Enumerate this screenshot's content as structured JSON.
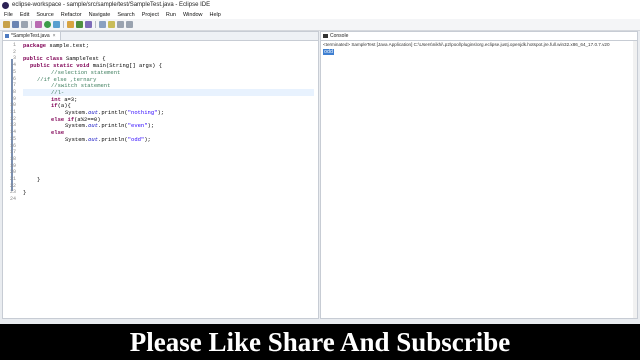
{
  "window": {
    "title": "eclipse-workspace - sample/src/sample/test/SampleTest.java - Eclipse IDE"
  },
  "menu": [
    "File",
    "Edit",
    "Source",
    "Refactor",
    "Navigate",
    "Search",
    "Project",
    "Run",
    "Window",
    "Help"
  ],
  "editor": {
    "tab_label": "*SampleTest.java",
    "lines": [
      {
        "n": "1",
        "t": ""
      },
      {
        "n": "2",
        "t": ""
      },
      {
        "n": "3",
        "t": ""
      },
      {
        "n": "4",
        "t": ""
      },
      {
        "n": "5",
        "t": ""
      },
      {
        "n": "6",
        "t": ""
      },
      {
        "n": "7",
        "t": ""
      },
      {
        "n": "8",
        "t": ""
      },
      {
        "n": "9",
        "t": ""
      },
      {
        "n": "10",
        "t": ""
      },
      {
        "n": "11",
        "t": ""
      },
      {
        "n": "12",
        "t": ""
      },
      {
        "n": "13",
        "t": ""
      },
      {
        "n": "14",
        "t": ""
      },
      {
        "n": "15",
        "t": ""
      },
      {
        "n": "16",
        "t": ""
      },
      {
        "n": "17",
        "t": ""
      },
      {
        "n": "18",
        "t": ""
      },
      {
        "n": "19",
        "t": ""
      },
      {
        "n": "20",
        "t": ""
      },
      {
        "n": "21",
        "t": ""
      },
      {
        "n": "22",
        "t": ""
      },
      {
        "n": "23",
        "t": ""
      },
      {
        "n": "24",
        "t": ""
      }
    ],
    "code": {
      "l1_kw": "package",
      "l1_rest": " sample.test;",
      "l3_kw1": "public",
      "l3_kw2": "class",
      "l3_rest": " SampleTest {",
      "l4_kw1": "public",
      "l4_kw2": "static",
      "l4_kw3": "void",
      "l4_rest": " main(String[] args) {",
      "l5": "//selection statement",
      "l6": "//if else ,ternary",
      "l7": "//switch statement",
      "l8": "//l-",
      "l9_kw": "int",
      "l9_rest": " a=3;",
      "l10_kw": "if",
      "l10_rest": "(a){",
      "l11_a": "System.",
      "l11_fld": "out",
      "l11_b": ".println(",
      "l11_str": "\"nothing\"",
      "l11_c": ");",
      "l12_kw1": "else",
      "l12_kw2": "if",
      "l12_rest": "(a%2==0)",
      "l13_a": "System.",
      "l13_fld": "out",
      "l13_b": ".println(",
      "l13_str": "\"even\"",
      "l13_c": ");",
      "l14_kw": "else",
      "l15_a": "System.",
      "l15_fld": "out",
      "l15_b": ".println(",
      "l15_str": "\"odd\"",
      "l15_c": ");",
      "l21": "}",
      "l23": "}"
    }
  },
  "console": {
    "tab_label": "Console",
    "terminated": "<terminated> SampleTest [Java Application] C:\\Users\\nikhi\\.p2\\pool\\plugins\\org.eclipse.justj.openjdk.hotspot.jre.full.win32.x86_64_17.0.7.v20",
    "output": "odd"
  },
  "banner": {
    "text": "Please Like Share And Subscribe"
  },
  "colors": {
    "banner_bg": "#000000",
    "keyword": "#7f0055",
    "comment": "#3f7f5f",
    "string": "#2a00ff"
  }
}
